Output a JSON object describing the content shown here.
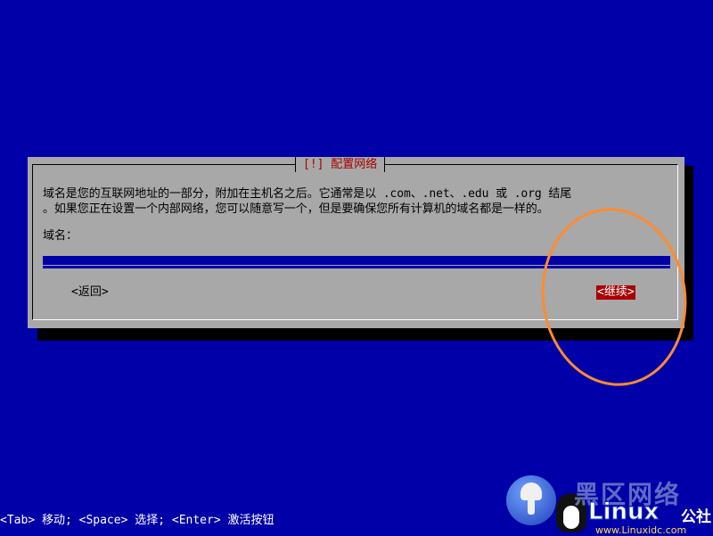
{
  "dialog": {
    "title": "[!] 配置网络",
    "message_line1": "域名是您的互联网地址的一部分，附加在主机名之后。它通常是以 .com、.net、.edu 或 .org 结尾",
    "message_line2": "。如果您正在设置一个内部网络，您可以随意写一个，但是要确保您所有计算机的域名都是一样的。",
    "field_label": "域名：",
    "field_value": "",
    "back_label": "<返回>",
    "continue_label": "<继续>"
  },
  "statusbar": {
    "text": "<Tab> 移动; <Space> 选择; <Enter> 激活按钮"
  },
  "watermark": {
    "top_text": "黑区网络",
    "brand": "Linux",
    "brand_suffix": "公社",
    "url": "www.Linuxidc.com"
  },
  "colors": {
    "background": "#0000a8",
    "dialog": "#a8a8a8",
    "title_text": "#a80000",
    "selected_button": "#a80000",
    "annotation_ring": "#ff8c2e"
  }
}
